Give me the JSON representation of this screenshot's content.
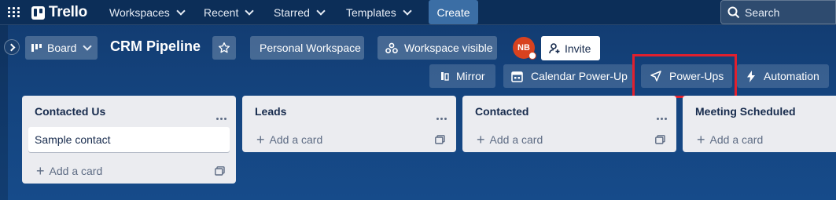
{
  "topbar": {
    "app_name": "Trello",
    "nav": [
      {
        "label": "Workspaces"
      },
      {
        "label": "Recent"
      },
      {
        "label": "Starred"
      },
      {
        "label": "Templates"
      }
    ],
    "create_label": "Create",
    "search_placeholder": "Search"
  },
  "board_header": {
    "view_label": "Board",
    "title": "CRM Pipeline",
    "workspace_label": "Personal Workspace",
    "visibility_label": "Workspace visible",
    "member_initials": "NB",
    "invite_label": "Invite",
    "powerups": {
      "mirror": "Mirror",
      "calendar": "Calendar Power-Up",
      "power_ups": "Power-Ups",
      "automation": "Automation"
    }
  },
  "lists": [
    {
      "title": "Contacted Us",
      "cards": [
        "Sample contact"
      ],
      "add_label": "Add a card"
    },
    {
      "title": "Leads",
      "cards": [],
      "add_label": "Add a card"
    },
    {
      "title": "Contacted",
      "cards": [],
      "add_label": "Add a card"
    },
    {
      "title": "Meeting Scheduled",
      "cards": [],
      "add_label": "Add a card"
    }
  ],
  "colors": {
    "topbar": "#0c2e58",
    "board_bg": "#14437d",
    "list_bg": "#ebecf0",
    "highlight": "#e0202e",
    "avatar": "#d8421f"
  }
}
